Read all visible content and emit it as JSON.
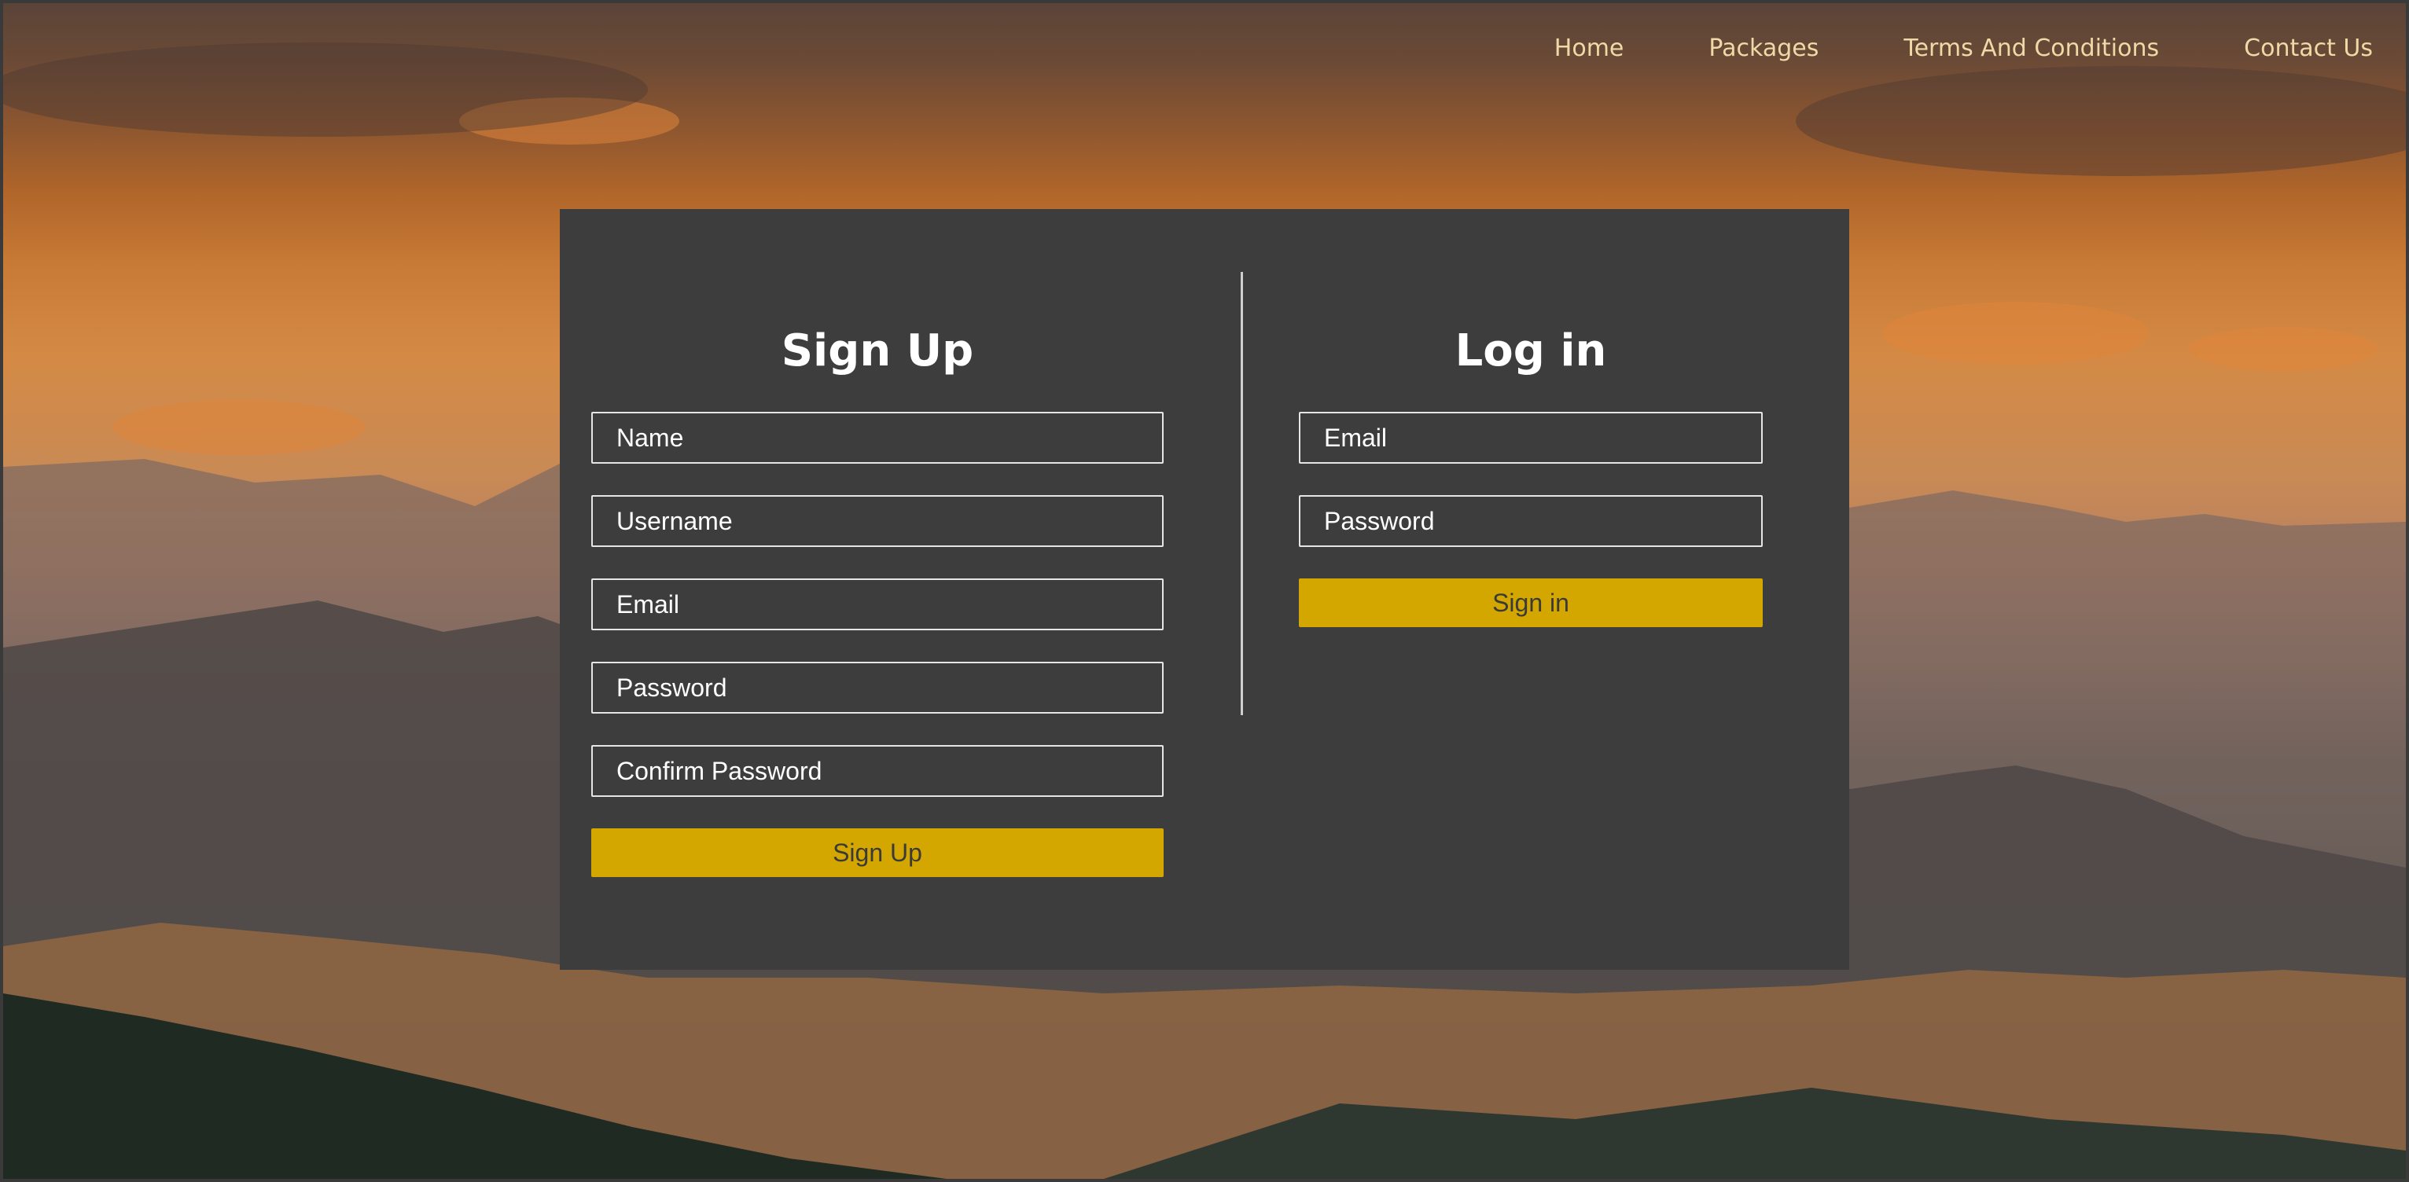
{
  "nav": {
    "items": [
      {
        "label": "Home"
      },
      {
        "label": "Packages"
      },
      {
        "label": "Terms And Conditions"
      },
      {
        "label": "Contact Us"
      }
    ]
  },
  "signup": {
    "title": "Sign Up",
    "fields": [
      {
        "placeholder": "Name"
      },
      {
        "placeholder": "Username"
      },
      {
        "placeholder": "Email"
      },
      {
        "placeholder": "Password"
      },
      {
        "placeholder": "Confirm Password"
      }
    ],
    "button": "Sign Up"
  },
  "login": {
    "title": "Log in",
    "fields": [
      {
        "placeholder": "Email"
      },
      {
        "placeholder": "Password"
      }
    ],
    "button": "Sign in"
  },
  "colors": {
    "accent": "#d4a700",
    "card": "#3d3d3d",
    "nav_text": "#efd9a6"
  }
}
